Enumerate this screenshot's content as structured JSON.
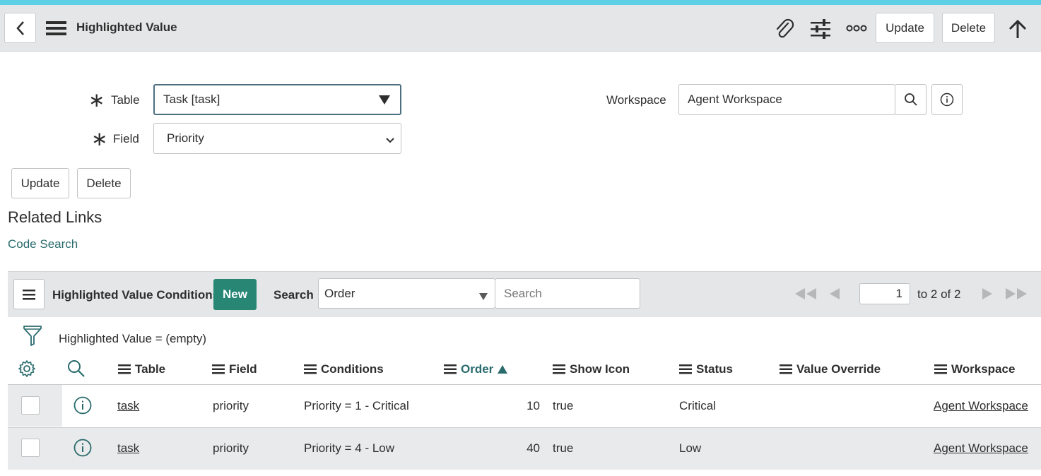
{
  "header": {
    "title": "Highlighted Value",
    "update_label": "Update",
    "delete_label": "Delete"
  },
  "form": {
    "table_label": "Table",
    "table_value": "Task [task]",
    "field_label": "Field",
    "field_value": "Priority",
    "workspace_label": "Workspace",
    "workspace_value": "Agent Workspace",
    "update_label": "Update",
    "delete_label": "Delete",
    "required_mark": "∗"
  },
  "related": {
    "heading": "Related Links",
    "code_search": "Code Search"
  },
  "list": {
    "title": "Highlighted Value Conditions",
    "new_label": "New",
    "search_label": "Search",
    "search_field": "Order",
    "search_placeholder": "Search",
    "page_number": "1",
    "page_range": "to 2 of 2",
    "filter_text": "Highlighted Value = (empty)",
    "columns": [
      "Table",
      "Field",
      "Conditions",
      "Order",
      "Show Icon",
      "Status",
      "Value Override",
      "Workspace"
    ],
    "rows": [
      {
        "table": "task",
        "field": "priority",
        "conditions": "Priority = 1 - Critical",
        "order": "10",
        "show_icon": "true",
        "status": "Critical",
        "value_override": "",
        "workspace": "Agent Workspace"
      },
      {
        "table": "task",
        "field": "priority",
        "conditions": "Priority = 4 - Low",
        "order": "40",
        "show_icon": "true",
        "status": "Low",
        "value_override": "",
        "workspace": "Agent Workspace"
      }
    ]
  },
  "colors": {
    "accent_stripe": "#5ed0e6",
    "new_button": "#278674",
    "link_teal": "#2a6b6d"
  }
}
